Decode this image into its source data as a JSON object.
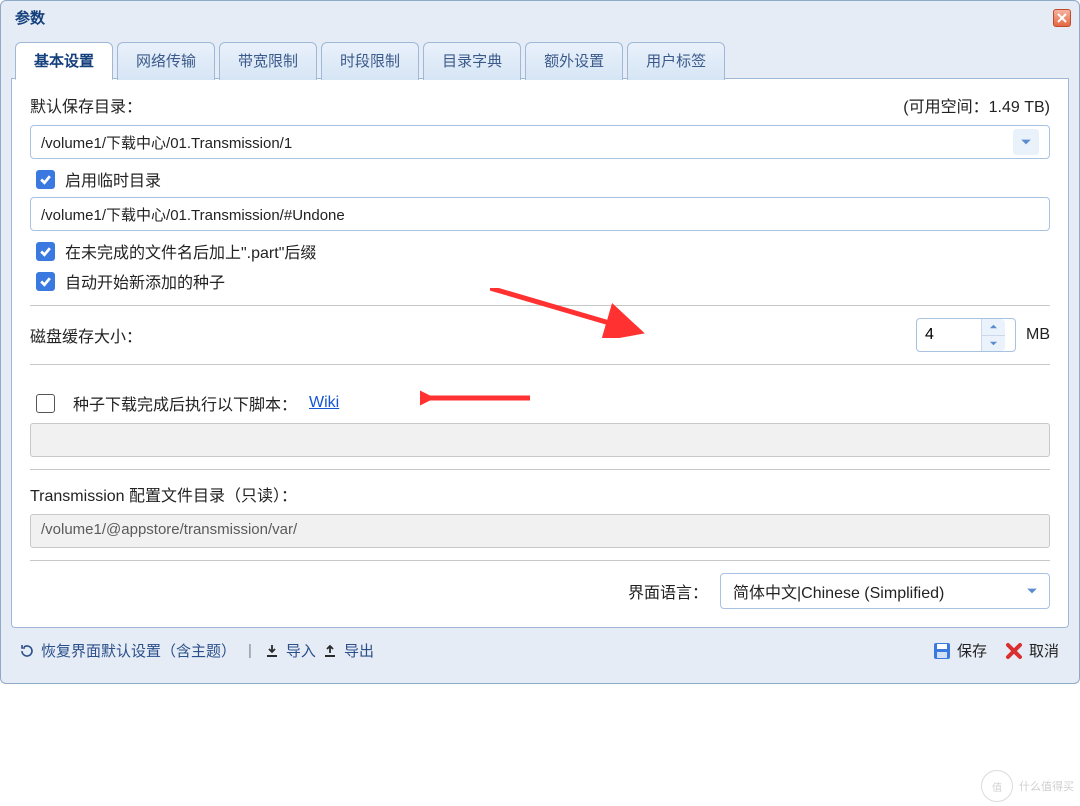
{
  "dialog": {
    "title": "参数"
  },
  "tabs": {
    "items": [
      {
        "label": "基本设置"
      },
      {
        "label": "网络传输"
      },
      {
        "label": "带宽限制"
      },
      {
        "label": "时段限制"
      },
      {
        "label": "目录字典"
      },
      {
        "label": "额外设置"
      },
      {
        "label": "用户标签"
      }
    ]
  },
  "saveDir": {
    "label": "默认保存目录：",
    "availSpace": "(可用空间：1.49 TB)",
    "value": "/volume1/下载中心/01.Transmission/1"
  },
  "tempDir": {
    "enableLabel": "启用临时目录",
    "value": "/volume1/下载中心/01.Transmission/#Undone"
  },
  "options": {
    "partSuffix": "在未完成的文件名后加上\".part\"后缀",
    "autoStart": "自动开始新添加的种子"
  },
  "cache": {
    "label": "磁盘缓存大小：",
    "value": "4",
    "unit": "MB"
  },
  "script": {
    "label": "种子下载完成后执行以下脚本：",
    "link": "Wiki"
  },
  "configDir": {
    "label": "Transmission 配置文件目录（只读）：",
    "value": "/volume1/@appstore/transmission/var/"
  },
  "lang": {
    "label": "界面语言：",
    "value": "简体中文|Chinese (Simplified)"
  },
  "footer": {
    "restore": "恢复界面默认设置（含主题）",
    "import": "导入",
    "export": "导出",
    "save": "保存",
    "cancel": "取消"
  },
  "watermark": {
    "text": "什么值得买"
  }
}
